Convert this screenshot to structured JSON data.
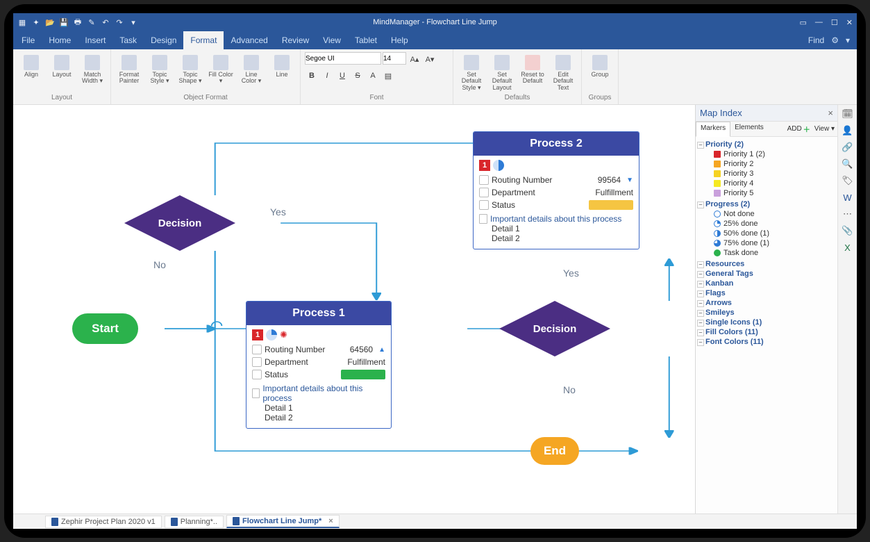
{
  "titlebar": {
    "app_title": "MindManager - Flowchart Line Jump"
  },
  "menu": {
    "tabs": [
      "File",
      "Home",
      "Insert",
      "Task",
      "Design",
      "Format",
      "Advanced",
      "Review",
      "View",
      "Tablet",
      "Help"
    ],
    "active_index": 5,
    "find_label": "Find"
  },
  "ribbon": {
    "groups": {
      "layout": {
        "label": "Layout",
        "buttons": [
          "Align",
          "Layout",
          "Match Width ▾"
        ]
      },
      "object_format": {
        "label": "Object Format",
        "buttons": [
          "Format Painter",
          "Topic Style ▾",
          "Topic Shape ▾",
          "Fill Color ▾",
          "Line Color ▾",
          "Line"
        ]
      },
      "font": {
        "label": "Font",
        "font_name": "Segoe UI",
        "font_size": "14",
        "bold": "B",
        "italic": "I",
        "underline": "U",
        "strike": "S",
        "fontcolor": "A",
        "grow": "A▴",
        "shrink": "A▾"
      },
      "defaults": {
        "label": "Defaults",
        "buttons": [
          "Set Default Style ▾",
          "Set Default Layout",
          "Reset to Default",
          "Edit Default Text"
        ]
      },
      "groups_grp": {
        "label": "Groups",
        "buttons": [
          "Group"
        ]
      }
    }
  },
  "flowchart": {
    "start": "Start",
    "end": "End",
    "decision1": "Decision",
    "decision2": "Decision",
    "edge_labels": {
      "yes1": "Yes",
      "no1": "No",
      "yes2": "Yes",
      "no2": "No"
    },
    "process1": {
      "title": "Process 1",
      "priority": "1",
      "rows": {
        "routing_k": "Routing Number",
        "routing_v": "64560",
        "dept_k": "Department",
        "dept_v": "Fulfillment",
        "status_k": "Status"
      },
      "status_color": "#2bb24c",
      "note_h": "Important details about this process",
      "detail1": "Detail 1",
      "detail2": "Detail 2"
    },
    "process2": {
      "title": "Process 2",
      "priority": "1",
      "rows": {
        "routing_k": "Routing Number",
        "routing_v": "99564",
        "dept_k": "Department",
        "dept_v": "Fulfillment",
        "status_k": "Status"
      },
      "status_color": "#f5c542",
      "note_h": "Important details about this process",
      "detail1": "Detail 1",
      "detail2": "Detail 2"
    }
  },
  "mapindex": {
    "title": "Map Index",
    "tabs": [
      "Markers",
      "Elements"
    ],
    "active_tab": 0,
    "add": "ADD",
    "view": "View ▾",
    "tree": {
      "priority_h": "Priority (2)",
      "priority_items": [
        "Priority 1 (2)",
        "Priority 2",
        "Priority 3",
        "Priority 4",
        "Priority 5"
      ],
      "priority_colors": [
        "#d9262b",
        "#f5a623",
        "#f5d223",
        "#f5e923",
        "#c9a0dc"
      ],
      "progress_h": "Progress (2)",
      "progress_items": [
        "Not done",
        "25% done",
        "50% done (1)",
        "75% done (1)",
        "Task done"
      ],
      "resources": "Resources",
      "general_tags": "General Tags",
      "kanban": "Kanban",
      "flags": "Flags",
      "arrows": "Arrows",
      "smileys": "Smileys",
      "single_icons": "Single Icons (1)",
      "fill_colors": "Fill Colors (11)",
      "font_colors": "Font Colors (11)"
    }
  },
  "doctabs": {
    "t1": "Zephir Project Plan 2020 v1",
    "t2": "Planning*..",
    "t3": "Flowchart Line Jump*"
  }
}
